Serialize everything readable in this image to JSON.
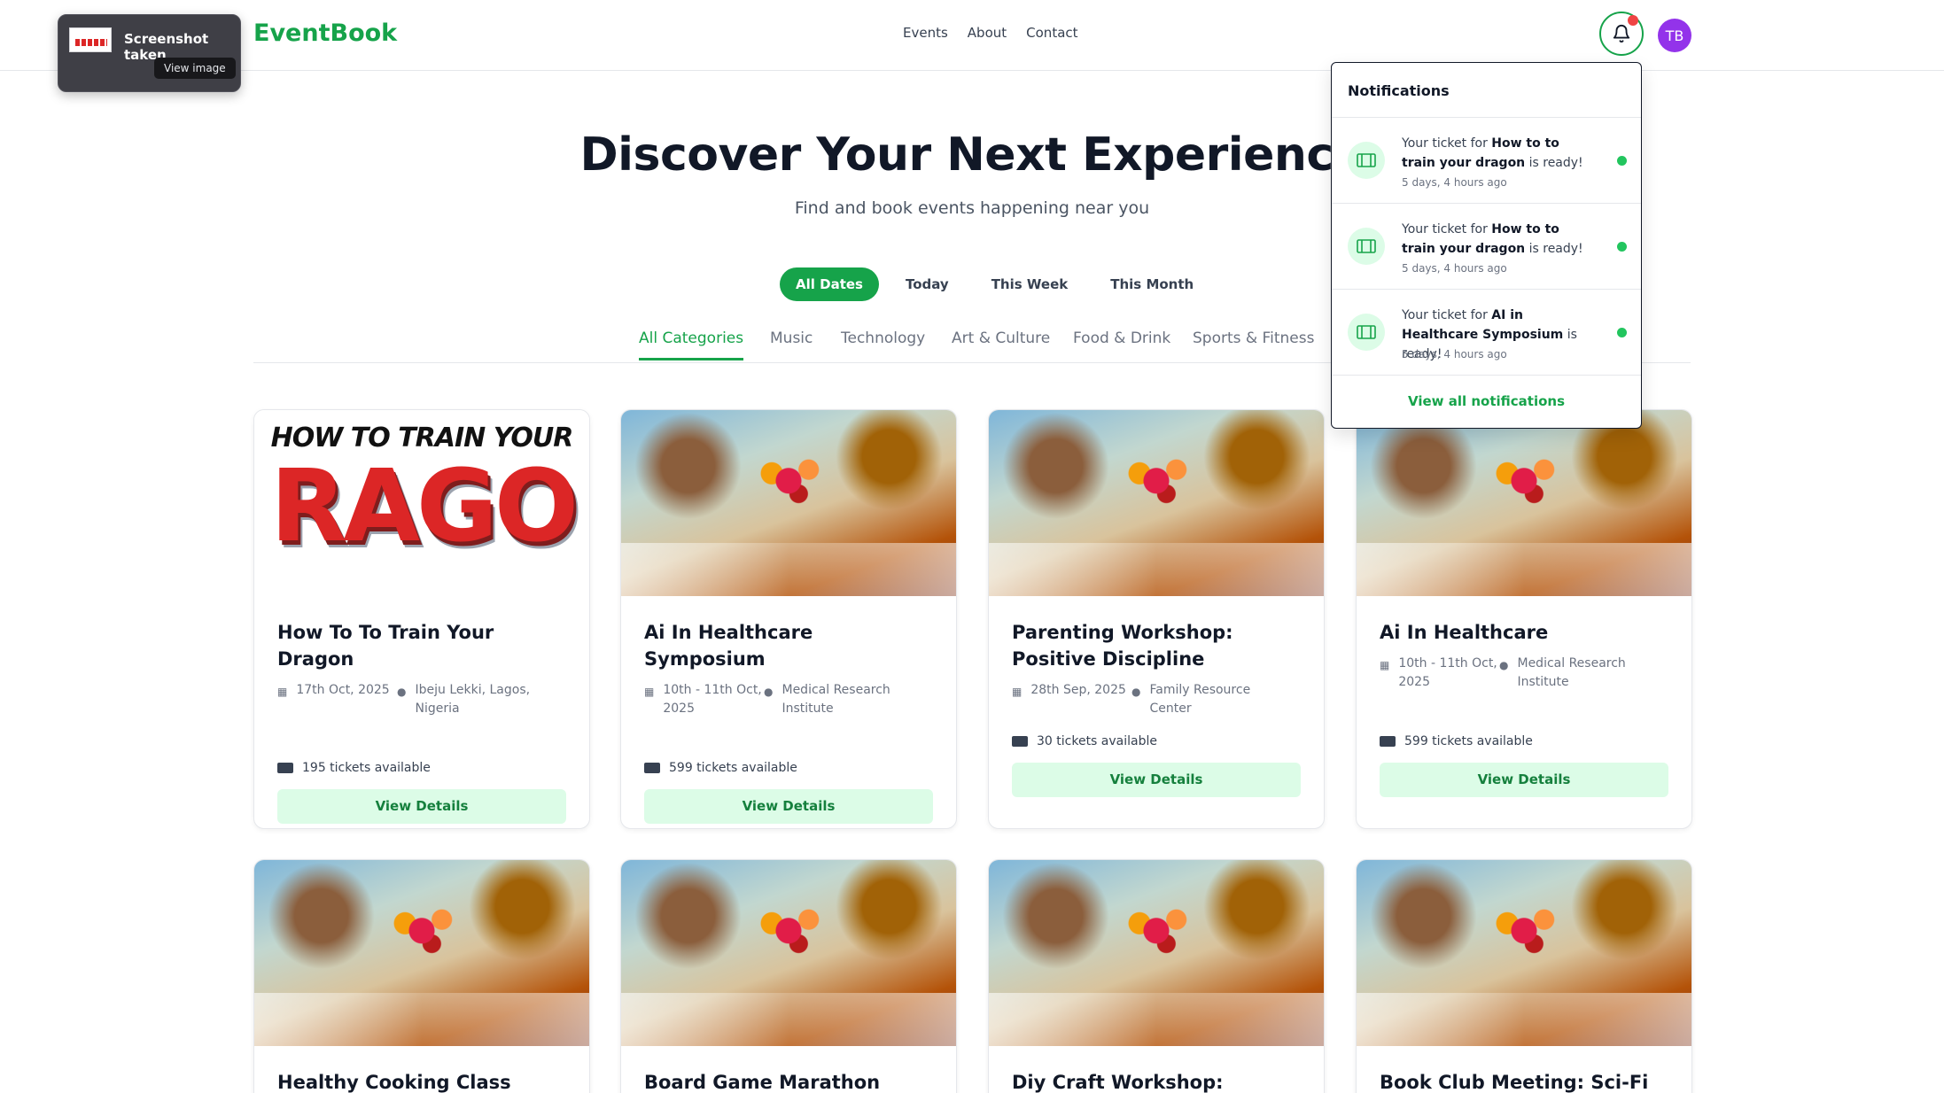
{
  "app": {
    "logo": "EventBook"
  },
  "nav": {
    "items": [
      "Events",
      "About",
      "Contact"
    ]
  },
  "user": {
    "initials": "TB"
  },
  "toast": {
    "title": "Screenshot taken",
    "button": "View image"
  },
  "hero": {
    "title": "Discover Your Next Experience",
    "subtitle": "Find and book events happening near you"
  },
  "date_filters": [
    "All Dates",
    "Today",
    "This Week",
    "This Month"
  ],
  "date_filter_active": "All Dates",
  "categories": [
    "All Categories",
    "Music",
    "Technology",
    "Art & Culture",
    "Food & Drink",
    "Sports & Fitness"
  ],
  "category_active": "All Categories",
  "events": [
    {
      "title": "How To To Train Your Dragon",
      "date": "17th Oct, 2025",
      "location": "Ibeju Lekki, Lagos, Nigeria",
      "tickets": "195 tickets available",
      "button": "View Details",
      "image": "dragon-poster",
      "image_text_top": "HOW TO TRAIN YOUR",
      "image_text_big": "RAGO"
    },
    {
      "title": "Ai In Healthcare Symposium",
      "date": "10th - 11th Oct, 2025",
      "location": "Medical Research Institute",
      "tickets": "599 tickets available",
      "button": "View Details",
      "image": "banquet-table"
    },
    {
      "title": "Parenting Workshop: Positive Discipline",
      "date": "28th Sep, 2025",
      "location": "Family Resource Center",
      "tickets": "30 tickets available",
      "button": "View Details",
      "image": "banquet-table"
    },
    {
      "title": "Ai In Healthcare",
      "date": "10th - 11th Oct, 2025",
      "location": "Medical Research Institute",
      "tickets": "599 tickets available",
      "button": "View Details",
      "image": "banquet-table"
    },
    {
      "title": "Healthy Cooking Class",
      "image": "banquet-table"
    },
    {
      "title": "Board Game Marathon",
      "image": "banquet-table"
    },
    {
      "title": "Diy Craft Workshop: Jewelry",
      "image": "banquet-table"
    },
    {
      "title": "Book Club Meeting: Sci-Fi",
      "image": "banquet-table"
    }
  ],
  "notifications": {
    "title": "Notifications",
    "items": [
      {
        "prefix": "Your ticket for ",
        "event": "How to to train your dragon",
        "suffix": " is ready!",
        "time": "5 days, 4 hours ago"
      },
      {
        "prefix": "Your ticket for ",
        "event": "How to to train your dragon",
        "suffix": " is ready!",
        "time": "5 days, 4 hours ago"
      },
      {
        "prefix": "Your ticket for ",
        "event": "AI in Healthcare Symposium",
        "suffix": " is ready!",
        "time": "5 days, 4 hours ago"
      }
    ],
    "footer": "View all notifications"
  },
  "colors": {
    "brand": "#16a34a",
    "brand_light": "#dcfce7",
    "unread_dot": "#22c55e",
    "badge": "#ef4444",
    "avatar": "#9333ea"
  }
}
